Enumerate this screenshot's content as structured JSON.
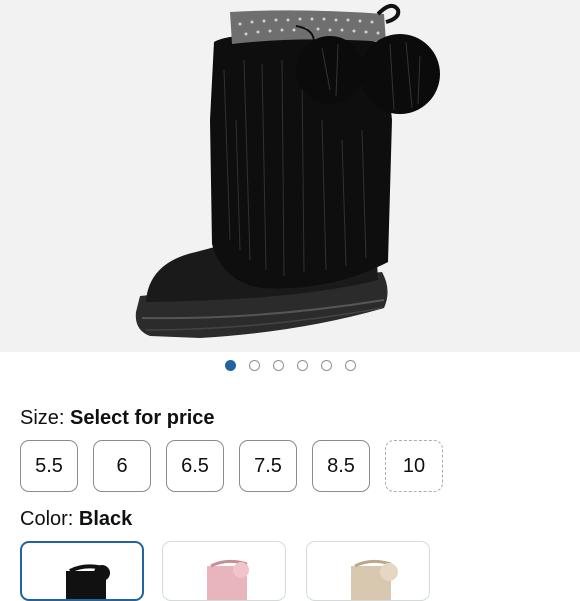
{
  "product": {
    "image_name": "black faux fur pom-pom boot",
    "carousel": {
      "count": 6,
      "active_index": 0
    }
  },
  "size": {
    "label": "Size:",
    "value": "Select for price",
    "options": [
      {
        "label": "5.5",
        "available": true
      },
      {
        "label": "6",
        "available": true
      },
      {
        "label": "6.5",
        "available": true
      },
      {
        "label": "7.5",
        "available": true
      },
      {
        "label": "8.5",
        "available": true
      },
      {
        "label": "10",
        "available": false
      }
    ]
  },
  "color": {
    "label": "Color:",
    "value": "Black",
    "options": [
      {
        "name": "black",
        "selected": true
      },
      {
        "name": "pink",
        "selected": false
      },
      {
        "name": "beige",
        "selected": false
      }
    ]
  },
  "colors": {
    "accent": "#2162a1",
    "border": "#888c8c",
    "hero_bg": "#f2f2f2"
  }
}
